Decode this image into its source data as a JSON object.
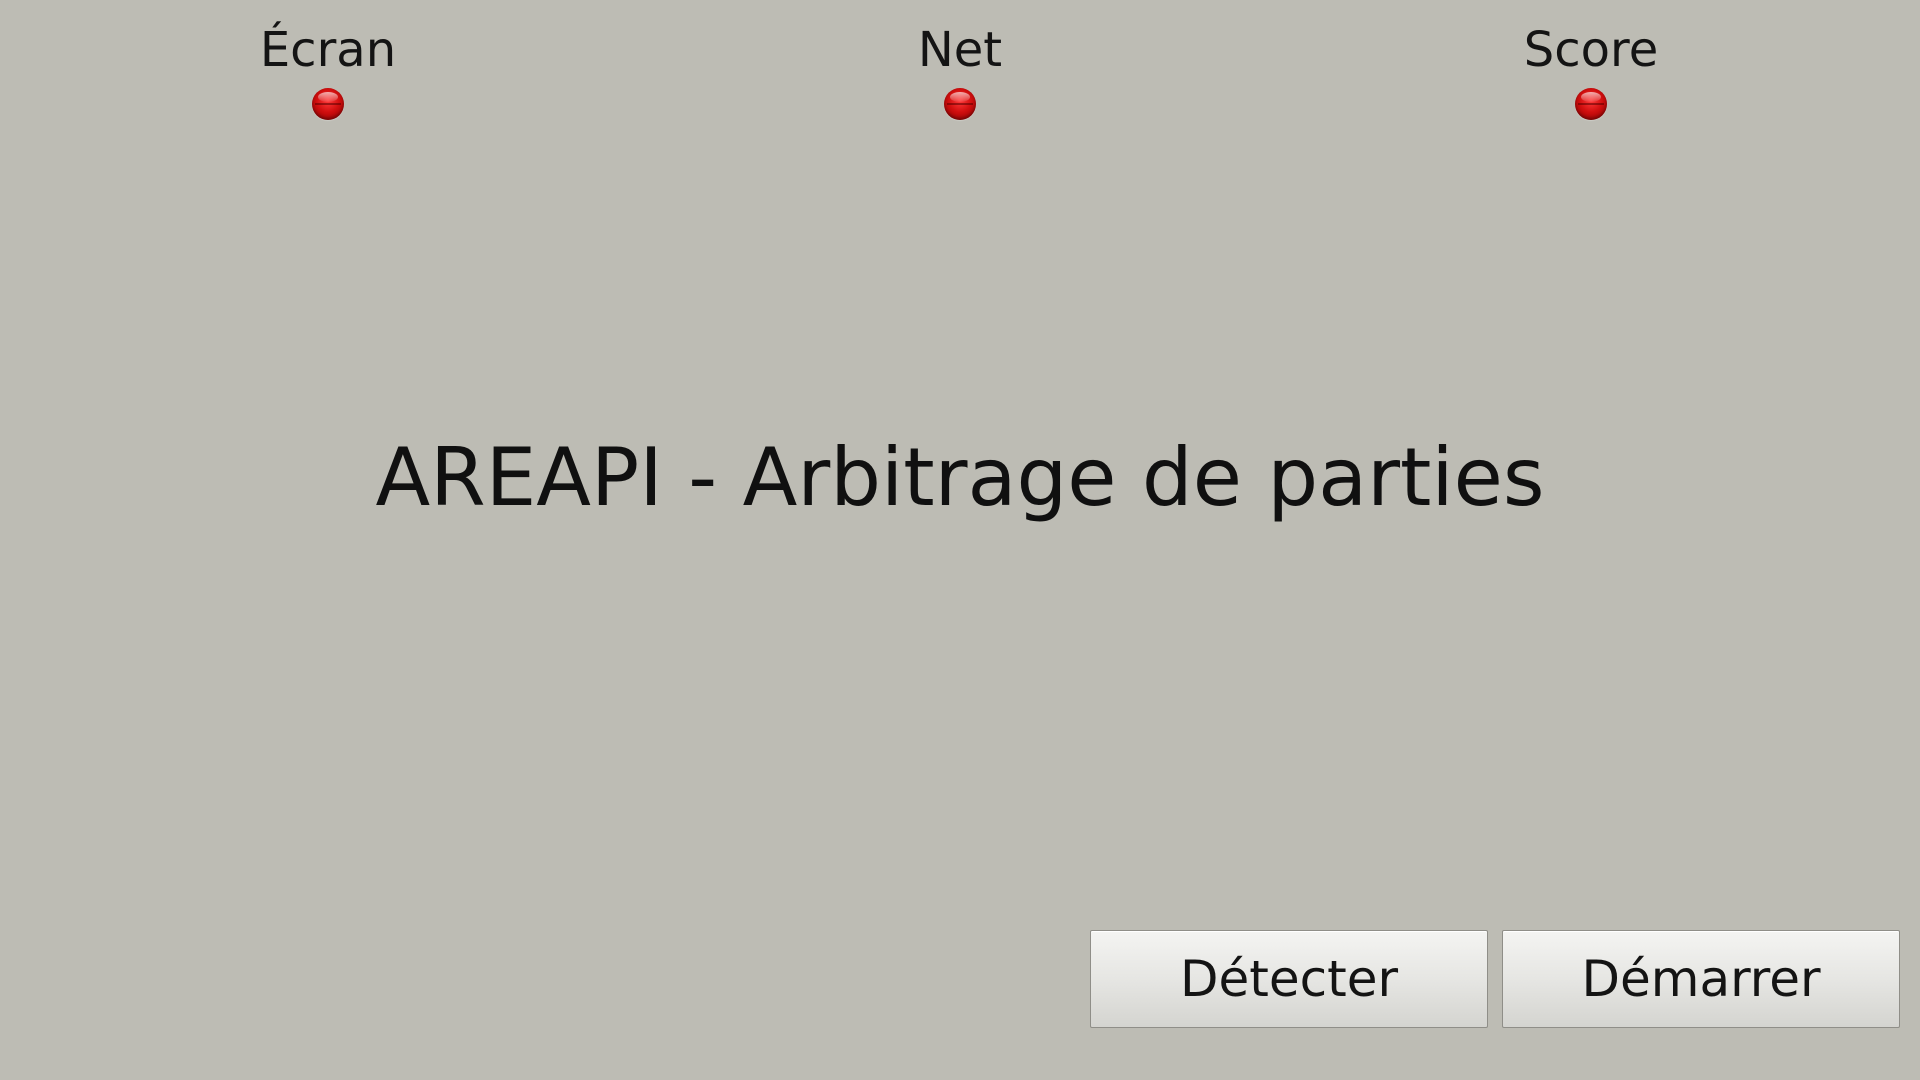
{
  "indicators": [
    {
      "label": "Écran",
      "status": "off",
      "color": "#d10f0f"
    },
    {
      "label": "Net",
      "status": "off",
      "color": "#d10f0f"
    },
    {
      "label": "Score",
      "status": "off",
      "color": "#d10f0f"
    }
  ],
  "title": "AREAPI - Arbitrage de parties",
  "buttons": {
    "detect_label": "Détecter",
    "start_label": "Démarrer"
  },
  "colors": {
    "background": "#bdbcb4",
    "led_off": "#d10f0f"
  }
}
